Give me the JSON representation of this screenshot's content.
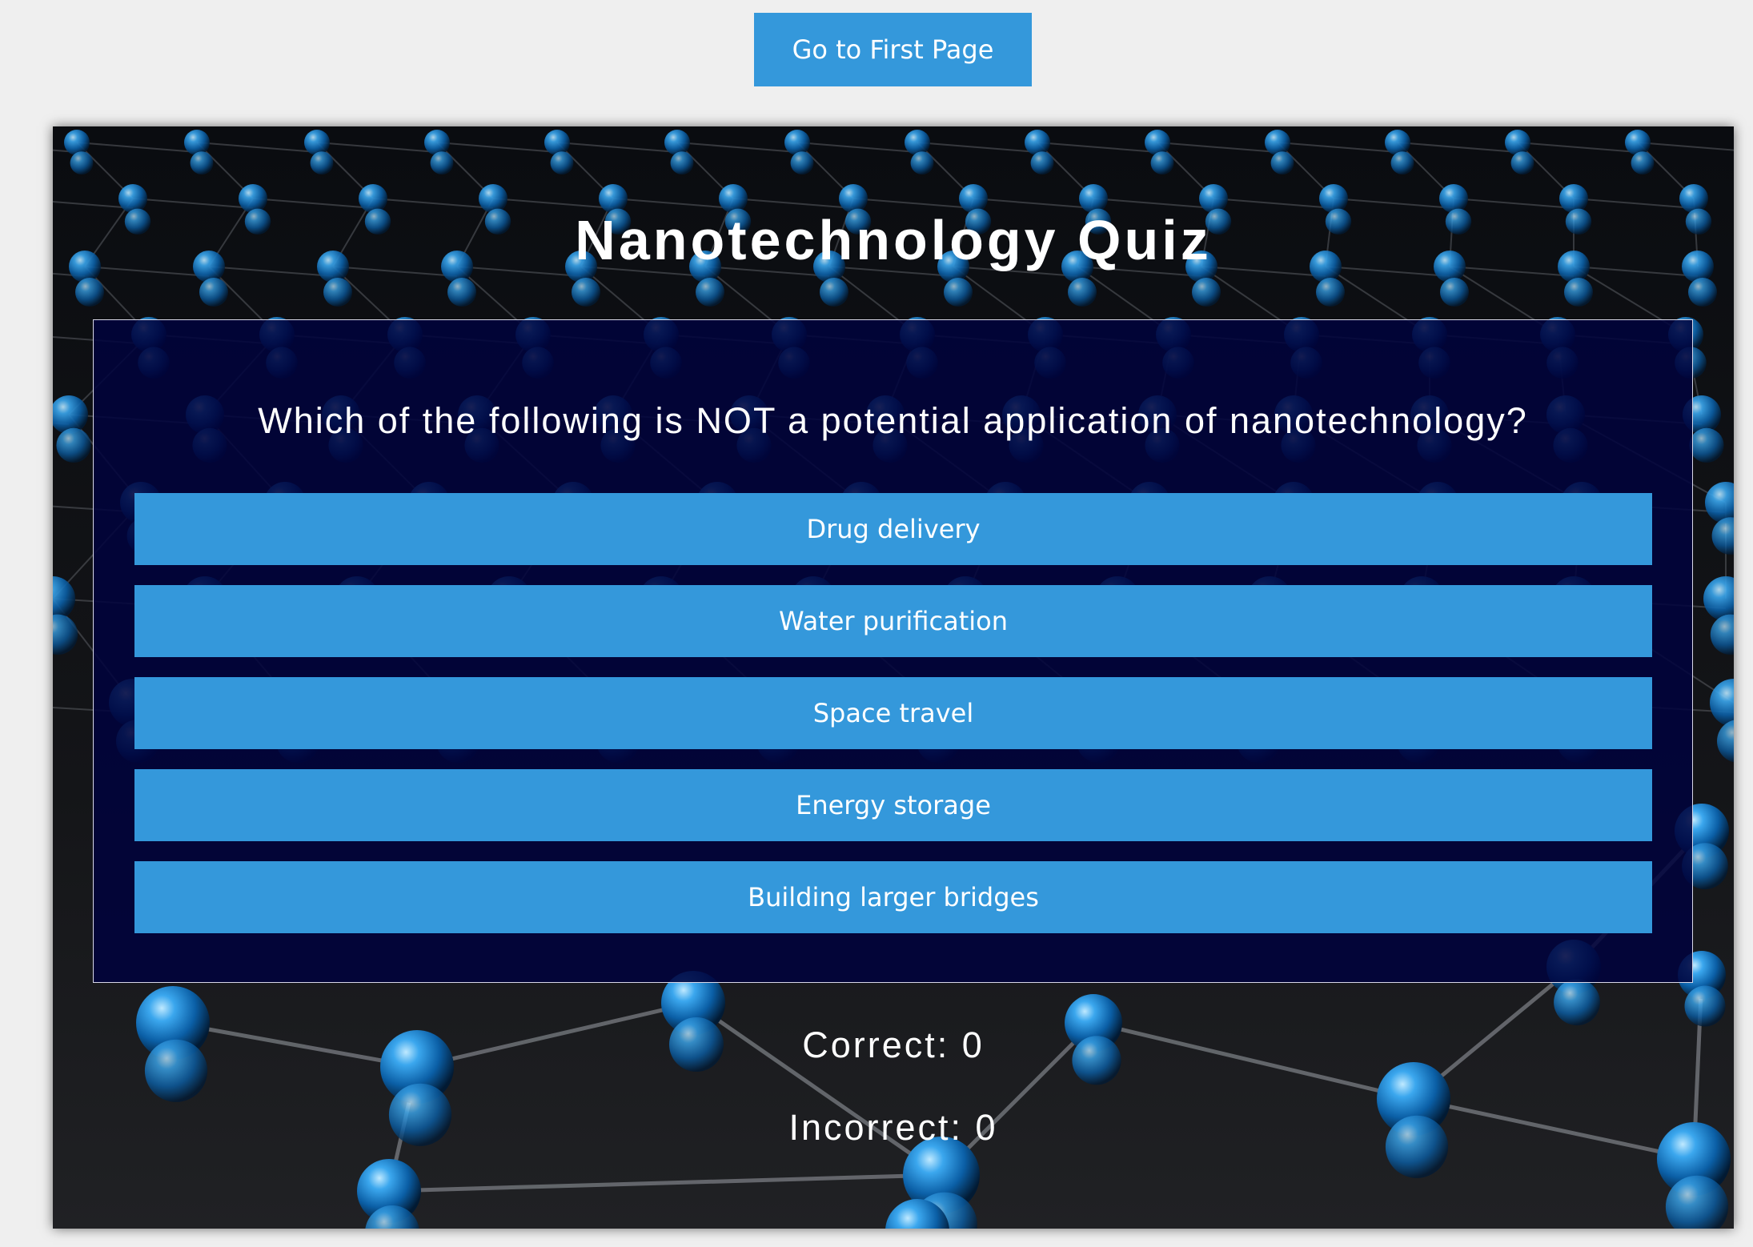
{
  "navigation": {
    "first_page_label": "Go to First Page"
  },
  "quiz": {
    "title": "Nanotechnology Quiz",
    "question": "Which of the following is NOT a potential application of nanotechnology?",
    "answers": [
      "Drug delivery",
      "Water purification",
      "Space travel",
      "Energy storage",
      "Building larger bridges"
    ]
  },
  "score": {
    "correct_label": "Correct: 0",
    "incorrect_label": "Incorrect: 0"
  },
  "colors": {
    "button_blue": "#3498db",
    "panel_navy": "#00023c",
    "page_background": "#efefef",
    "molecule_blue": "#1a7fd0"
  }
}
